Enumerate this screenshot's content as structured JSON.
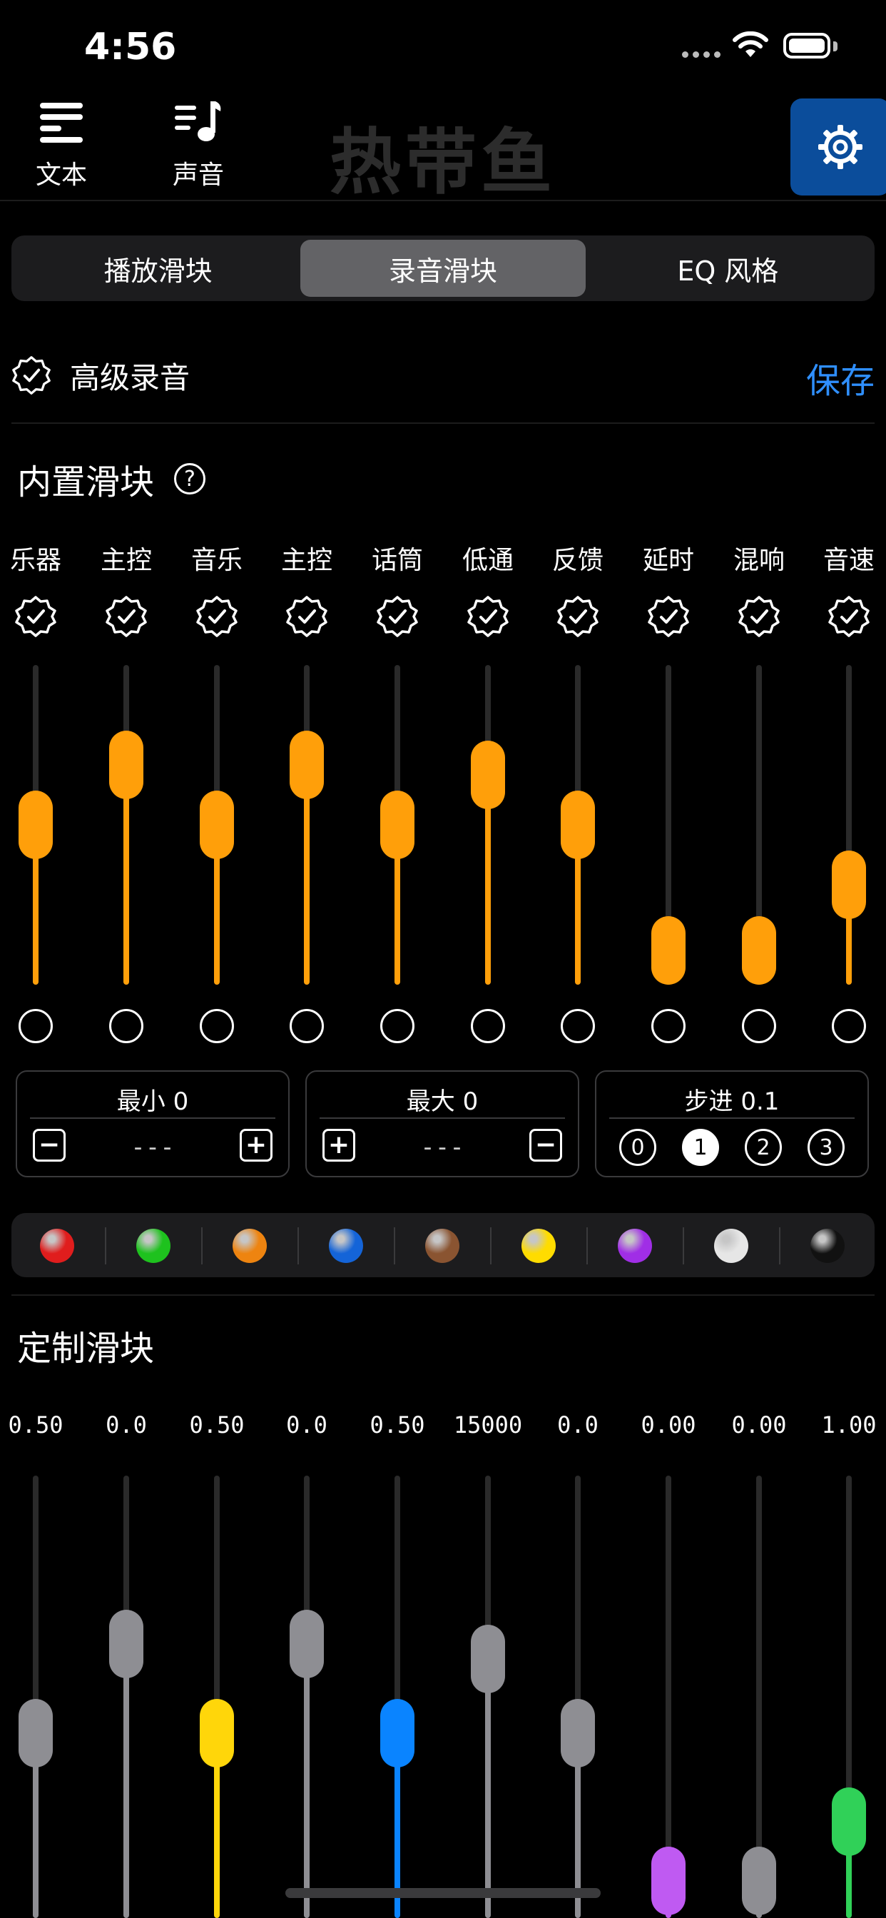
{
  "status_bar": {
    "time": "4:56"
  },
  "nav": {
    "text_label": "文本",
    "sound_label": "声音",
    "app_title": "热带鱼"
  },
  "tabs": [
    {
      "label": "播放滑块",
      "active": false
    },
    {
      "label": "录音滑块",
      "active": true
    },
    {
      "label": "EQ 风格",
      "active": false
    }
  ],
  "advanced": {
    "label": "高级录音",
    "save": "保存"
  },
  "builtin": {
    "title": "内置滑块",
    "help": "?",
    "sliders": [
      {
        "label": "乐器",
        "level": 0.5
      },
      {
        "label": "主控",
        "level": 0.74
      },
      {
        "label": "音乐",
        "level": 0.5
      },
      {
        "label": "主控",
        "level": 0.74
      },
      {
        "label": "话筒",
        "level": 0.5
      },
      {
        "label": "低通",
        "level": 0.7
      },
      {
        "label": "反馈",
        "level": 0.5
      },
      {
        "label": "延时",
        "level": 0.0
      },
      {
        "label": "混响",
        "level": 0.0
      },
      {
        "label": "音速",
        "level": 0.26
      }
    ]
  },
  "controls": {
    "min_title": "最小 0",
    "max_title": "最大 0",
    "step_title": "步进  0.1",
    "min_value": "---",
    "max_value": "---",
    "minus": "−",
    "plus": "+",
    "steps": [
      "0",
      "1",
      "2",
      "3"
    ],
    "active_step": 1
  },
  "palette": [
    "#e01d1d",
    "#1ec21e",
    "#ee8410",
    "#1464d8",
    "#8a5431",
    "#ffdc00",
    "#a02ee6",
    "#e6e6e6",
    "#111111"
  ],
  "custom": {
    "title": "定制滑块",
    "sliders": [
      {
        "value": "0.50",
        "level": 0.5,
        "color": "#8e8e93"
      },
      {
        "value": "0.0",
        "level": 0.8,
        "color": "#8e8e93"
      },
      {
        "value": "0.50",
        "level": 0.5,
        "color": "#ffd60a"
      },
      {
        "value": "0.0",
        "level": 0.8,
        "color": "#8e8e93"
      },
      {
        "value": "0.50",
        "level": 0.5,
        "color": "#0a84ff"
      },
      {
        "value": "15000",
        "level": 0.75,
        "color": "#8e8e93"
      },
      {
        "value": "0.0",
        "level": 0.5,
        "color": "#8e8e93"
      },
      {
        "value": "0.00",
        "level": 0.0,
        "color": "#bf5af2"
      },
      {
        "value": "0.00",
        "level": 0.0,
        "color": "#8e8e93"
      },
      {
        "value": "1.00",
        "level": 0.2,
        "color": "#30d158"
      }
    ]
  },
  "colors": {
    "accent": "#ff9f0a",
    "link": "#2f8fff",
    "settings_bg": "#0b4d9b"
  }
}
